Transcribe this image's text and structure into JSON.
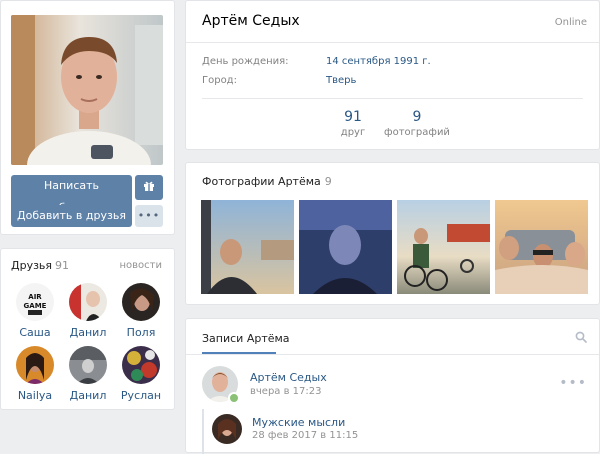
{
  "profile": {
    "name": "Артём Седых",
    "status": "Online",
    "info": [
      {
        "label": "День рождения:",
        "value": "14 сентября 1991 г."
      },
      {
        "label": "Город:",
        "value": "Тверь"
      }
    ],
    "stats": [
      {
        "count": "91",
        "label": "друг"
      },
      {
        "count": "9",
        "label": "фотографий"
      }
    ]
  },
  "actions": {
    "message_label": "Написать сообщение",
    "add_friend_label": "Добавить в друзья",
    "more_label": "•••",
    "gift_icon": "gift-icon"
  },
  "friends": {
    "title": "Друзья",
    "count": "91",
    "news_label": "новости",
    "items": [
      {
        "name": "Саша"
      },
      {
        "name": "Данил"
      },
      {
        "name": "Поля"
      },
      {
        "name": "Nailya"
      },
      {
        "name": "Данил"
      },
      {
        "name": "Руслан"
      }
    ]
  },
  "photos": {
    "title": "Фотографии Артёма",
    "count": "9"
  },
  "wall": {
    "tab_label": "Записи Артёма",
    "search_icon": "search-icon",
    "posts": [
      {
        "author": "Артём Седых",
        "time": "вчера в 17:23"
      },
      {
        "author": "Мужские мысли",
        "time": "28 фев 2017 в 11:15"
      }
    ]
  },
  "colors": {
    "background": "#edeef0",
    "link": "#2a5885",
    "primary_button": "#5e81a8",
    "secondary_button": "#dae2ea",
    "muted": "#939393"
  }
}
